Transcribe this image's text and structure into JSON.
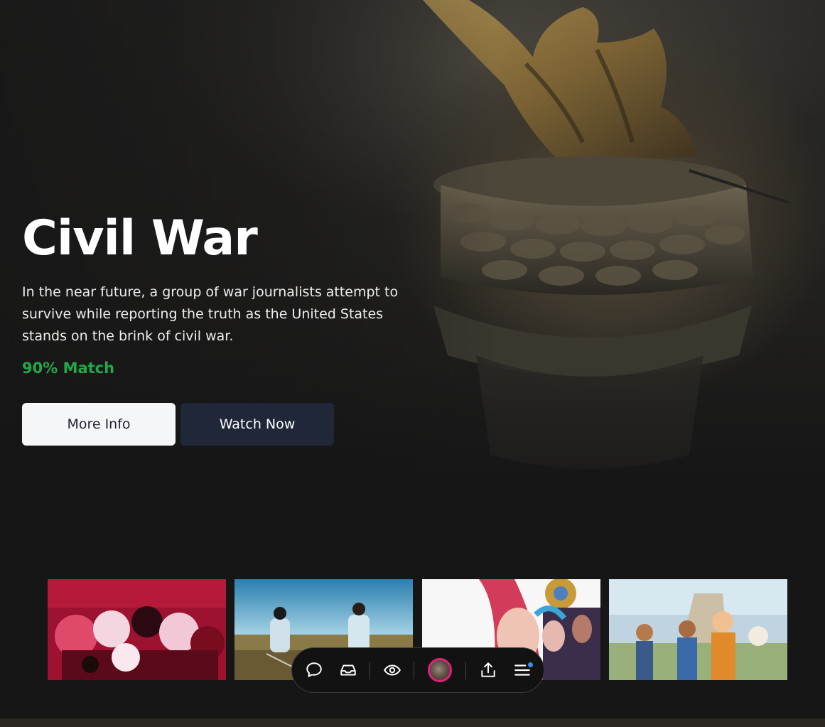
{
  "hero": {
    "title": "Civil War",
    "synopsis": "In the near future, a group of war journalists attempt to survive while reporting the truth as the United States stands on the brink of civil war.",
    "match": "90% Match",
    "more_info_label": "More Info",
    "watch_now_label": "Watch Now"
  },
  "thumbnails": [
    {
      "name": "hazbin-hotel"
    },
    {
      "name": "breaking-bad"
    },
    {
      "name": "arcane"
    },
    {
      "name": "avatar-the-last-airbender"
    }
  ],
  "toolbar": {
    "icons": [
      "chat-icon",
      "inbox-icon",
      "eye-icon",
      "avatar",
      "share-icon",
      "menu-icon"
    ],
    "notification_color": "#3a8ef0",
    "avatar_ring_color": "#e0207a"
  },
  "colors": {
    "background": "#161616",
    "match_green": "#22a84a",
    "watch_button": "#1f2738",
    "info_button": "#f5f6f8"
  }
}
